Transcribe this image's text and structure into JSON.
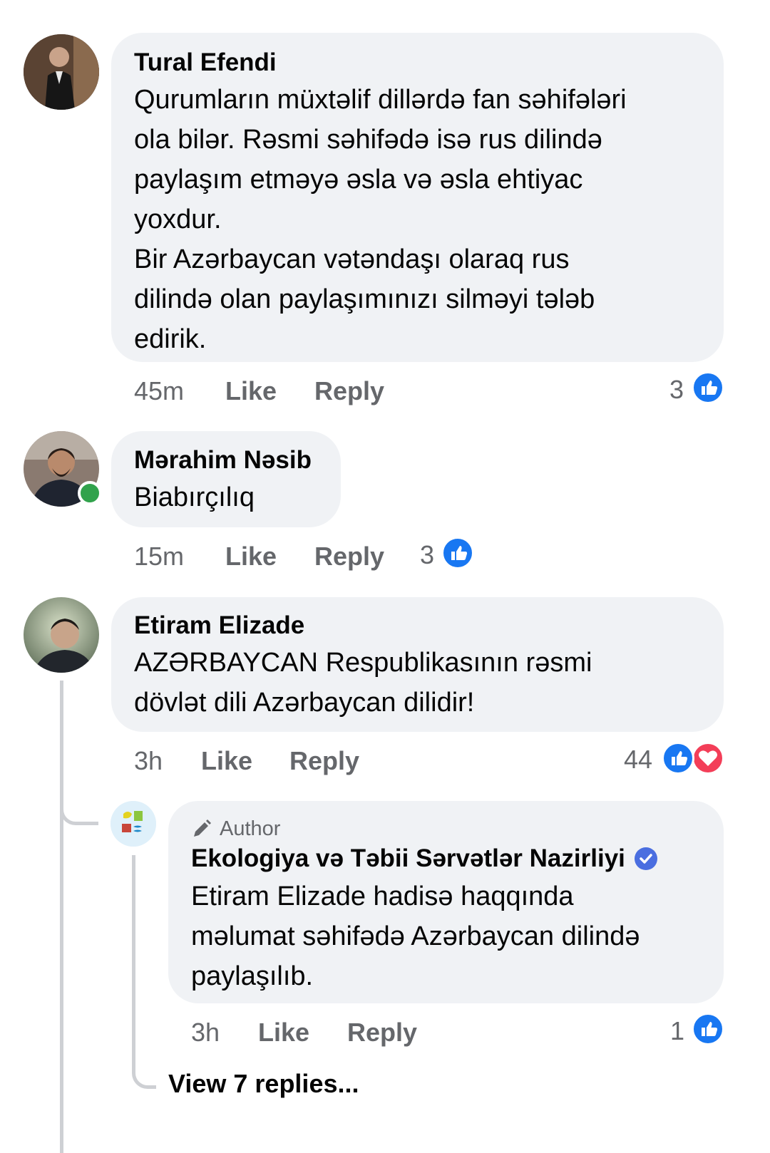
{
  "colors": {
    "bubble": "#f0f2f5",
    "meta": "#65676b",
    "like_blue": "#1877f2",
    "love_red": "#f33e58",
    "online_green": "#31a24c"
  },
  "comments": [
    {
      "author": "Tural Efendi",
      "lines": [
        "Qurumların müxtəlif dillərdə fan səhifələri",
        "ola bilər. Rəsmi səhifədə isə rus dilində",
        "paylaşım etməyə əsla və əsla ehtiyac",
        "yoxdur.",
        "Bir Azərbaycan vətəndaşı olaraq rus",
        "dilində olan paylaşımınızı silməyi tələb",
        "edirik."
      ],
      "time": "45m",
      "like": "Like",
      "reply": "Reply",
      "reactions": "3"
    },
    {
      "author": "Mərahim Nəsib",
      "lines": [
        "Biabırçılıq"
      ],
      "time": "15m",
      "like": "Like",
      "reply": "Reply",
      "reactions": "3"
    },
    {
      "author": "Etiram Elizade",
      "lines": [
        "AZƏRBAYCAN Respublikasının rəsmi",
        "dövlət dili Azərbaycan dilidir!"
      ],
      "time": "3h",
      "like": "Like",
      "reply": "Reply",
      "reactions": "44"
    }
  ],
  "reply": {
    "badge": "Author",
    "author": "Ekologiya və Təbii Sərvətlər Nazirliyi",
    "lines": [
      "Etiram Elizade hadisə haqqında",
      "məlumat səhifədə Azərbaycan dilində",
      "paylaşılıb."
    ],
    "time": "3h",
    "like": "Like",
    "reply": "Reply",
    "reactions": "1"
  },
  "view_replies": "View 7 replies..."
}
